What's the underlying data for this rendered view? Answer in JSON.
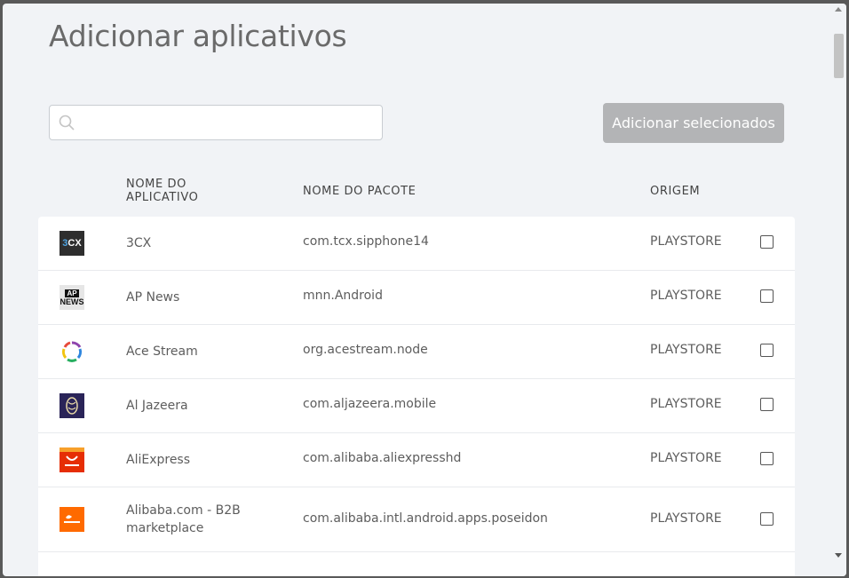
{
  "modal": {
    "title": "Adicionar aplicativos",
    "search_placeholder": "",
    "add_selected_label": "Adicionar selecionados"
  },
  "table": {
    "headers": {
      "name": "NOME DO APLICATIVO",
      "package": "NOME DO PACOTE",
      "origin": "ORIGEM"
    },
    "rows": [
      {
        "name": "3CX",
        "package": "com.tcx.sipphone14",
        "origin": "PLAYSTORE",
        "icon": "3cx-icon",
        "checked": false
      },
      {
        "name": "AP News",
        "package": "mnn.Android",
        "origin": "PLAYSTORE",
        "icon": "ap-news-icon",
        "checked": false
      },
      {
        "name": "Ace Stream",
        "package": "org.acestream.node",
        "origin": "PLAYSTORE",
        "icon": "ace-stream-icon",
        "checked": false
      },
      {
        "name": "Al Jazeera",
        "package": "com.aljazeera.mobile",
        "origin": "PLAYSTORE",
        "icon": "al-jazeera-icon",
        "checked": false
      },
      {
        "name": "AliExpress",
        "package": "com.alibaba.aliexpresshd",
        "origin": "PLAYSTORE",
        "icon": "aliexpress-icon",
        "checked": false
      },
      {
        "name": "Alibaba.com - B2B marketplace",
        "package": "com.alibaba.intl.android.apps.poseidon",
        "origin": "PLAYSTORE",
        "icon": "alibaba-icon",
        "checked": false
      }
    ]
  },
  "icons": {
    "3cx_text_a": "3",
    "3cx_text_b": "CX",
    "ap_text": "AP",
    "news_text": "NEWS"
  },
  "colors": {
    "button_disabled": "#b3b4b6",
    "modal_bg": "#f1f3f6"
  }
}
